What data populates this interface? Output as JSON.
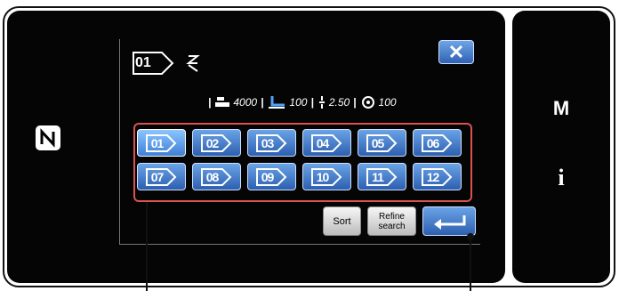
{
  "header": {
    "pattern_number": "01",
    "pattern_icon": "pattern-number-tag-icon",
    "suffix_icon": "edit-mark-icon"
  },
  "params": {
    "stitch_count": "4000",
    "presser_foot": "100",
    "pitch": "2.50",
    "speed": "100"
  },
  "buttons": {
    "close_label": "✕",
    "sort_label": "Sort",
    "refine_line1": "Refine",
    "refine_line2": "search",
    "m_label": "M",
    "info_label": "i"
  },
  "patterns": [
    {
      "label": "01",
      "selected": true
    },
    {
      "label": "02"
    },
    {
      "label": "03"
    },
    {
      "label": "04"
    },
    {
      "label": "05"
    },
    {
      "label": "06"
    },
    {
      "label": "07"
    },
    {
      "label": "08"
    },
    {
      "label": "09"
    },
    {
      "label": "10"
    },
    {
      "label": "11"
    },
    {
      "label": "12"
    }
  ],
  "colors": {
    "accent_blue": "#2d5fb0",
    "highlight_red": "#d9534f",
    "panel_black": "#050505"
  }
}
